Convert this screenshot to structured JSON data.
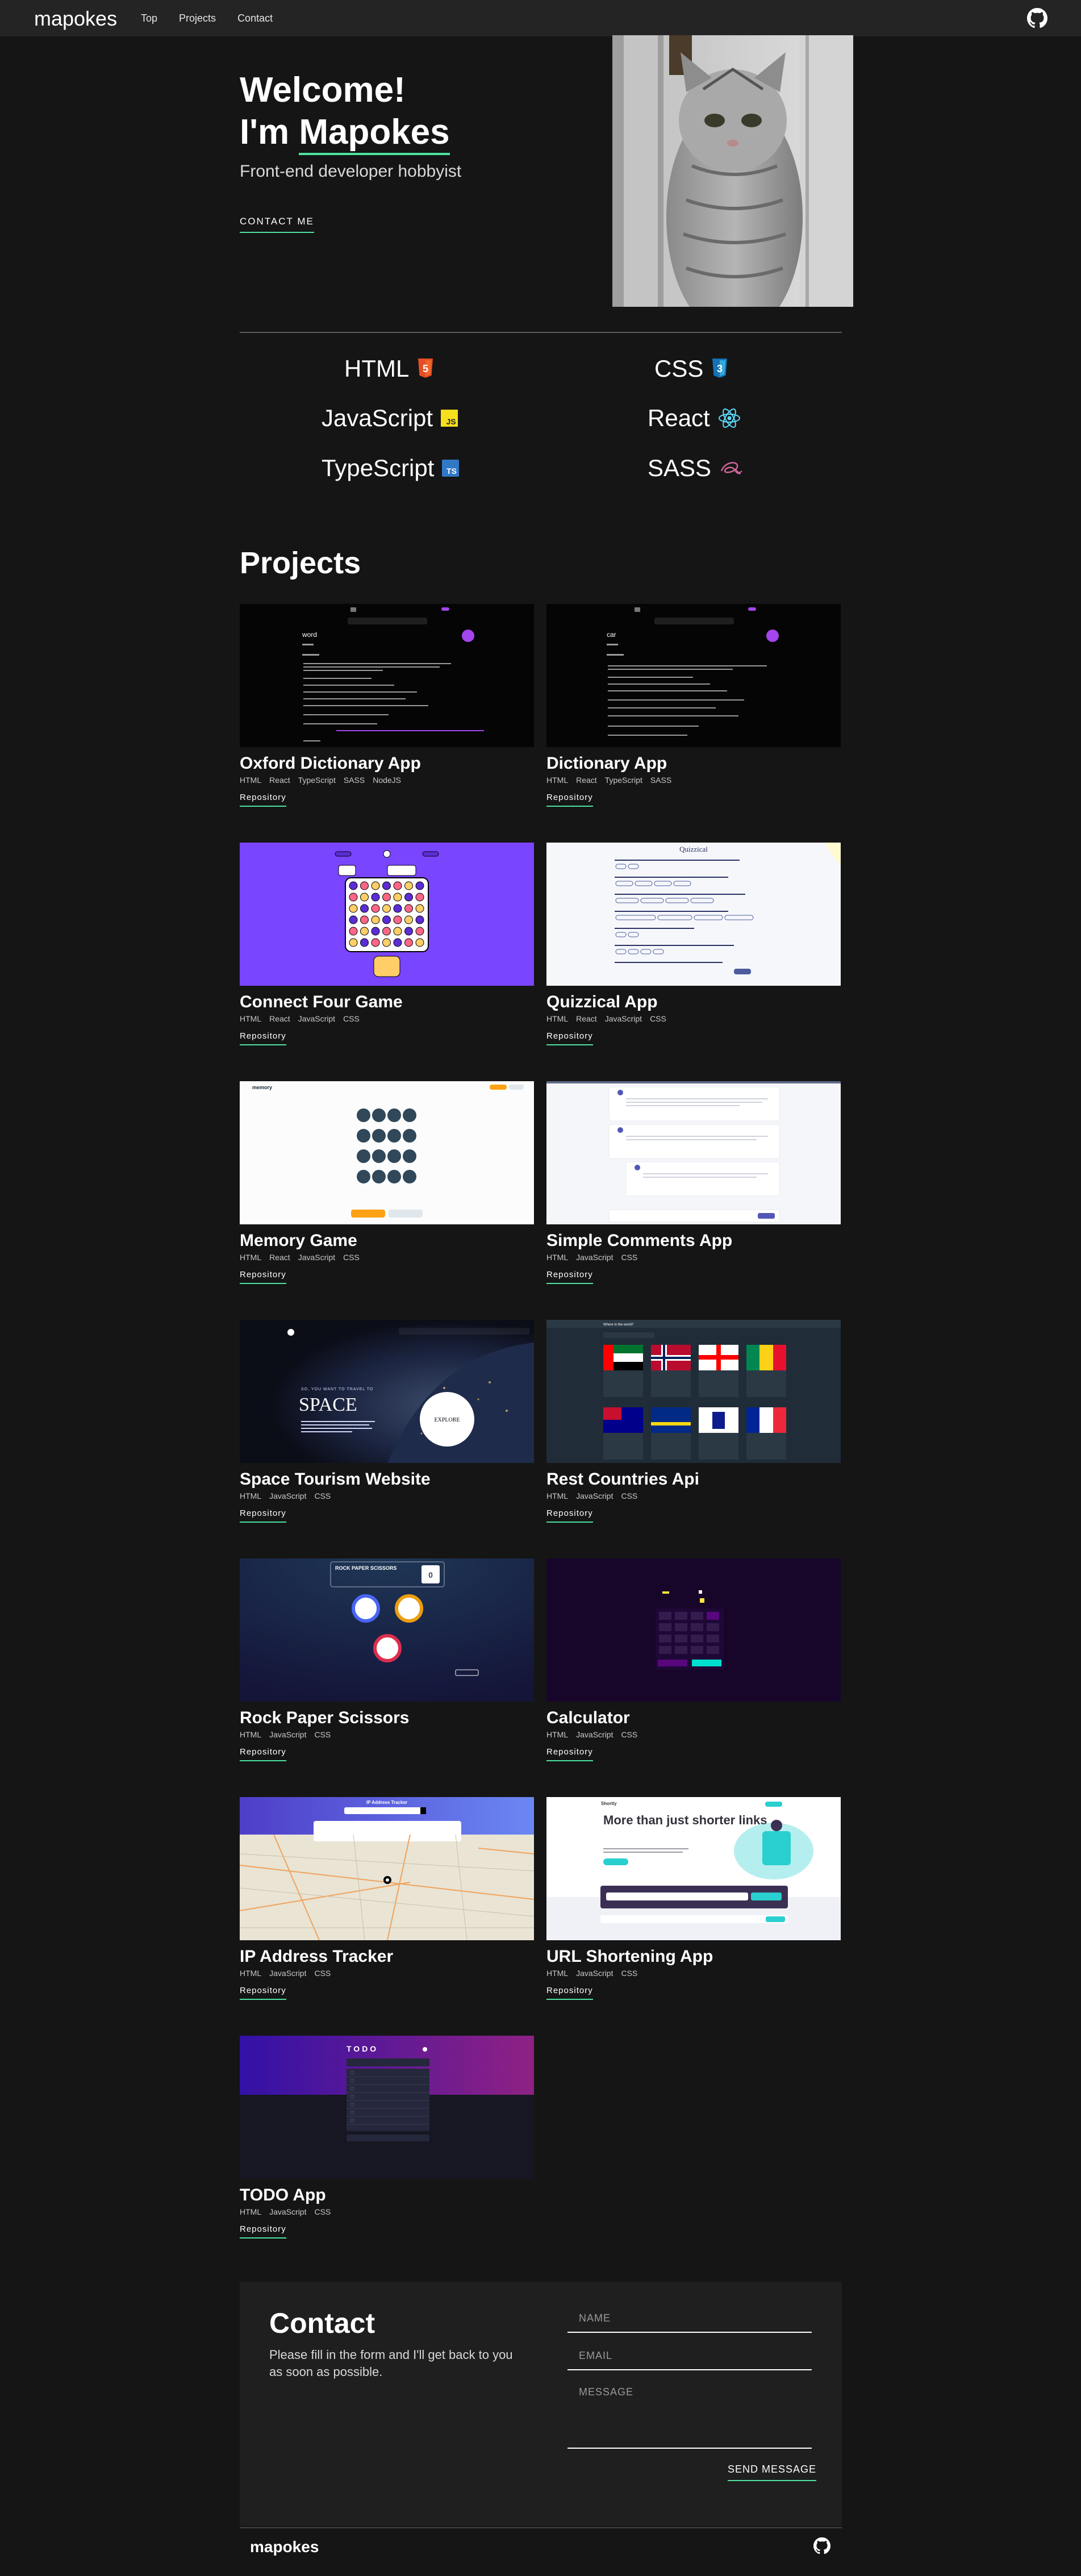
{
  "nav": {
    "brand": "mapokes",
    "links": [
      "Top",
      "Projects",
      "Contact"
    ],
    "github_icon": "github-icon"
  },
  "hero": {
    "title_line1": "Welcome!",
    "title_prefix": "I'm ",
    "title_name": "Mapokes",
    "subtitle": "Front-end developer hobbyist",
    "cta": "CONTACT ME",
    "image": "cat-photo"
  },
  "skills": [
    {
      "name": "HTML",
      "icon": "html5-icon"
    },
    {
      "name": "CSS",
      "icon": "css3-icon"
    },
    {
      "name": "JavaScript",
      "icon": "javascript-icon"
    },
    {
      "name": "React",
      "icon": "react-icon"
    },
    {
      "name": "TypeScript",
      "icon": "typescript-icon"
    },
    {
      "name": "SASS",
      "icon": "sass-icon"
    }
  ],
  "projects": {
    "heading": "Projects",
    "items": [
      {
        "title": "Oxford Dictionary App",
        "tags": [
          "HTML",
          "React",
          "TypeScript",
          "SASS",
          "NodeJS"
        ],
        "repo": "Repository"
      },
      {
        "title": "Dictionary App",
        "tags": [
          "HTML",
          "React",
          "TypeScript",
          "SASS"
        ],
        "repo": "Repository"
      },
      {
        "title": "Connect Four Game",
        "tags": [
          "HTML",
          "React",
          "JavaScript",
          "CSS"
        ],
        "repo": "Repository"
      },
      {
        "title": "Quizzical App",
        "tags": [
          "HTML",
          "React",
          "JavaScript",
          "CSS"
        ],
        "repo": "Repository"
      },
      {
        "title": "Memory Game",
        "tags": [
          "HTML",
          "React",
          "JavaScript",
          "CSS"
        ],
        "repo": "Repository"
      },
      {
        "title": "Simple Comments App",
        "tags": [
          "HTML",
          "JavaScript",
          "CSS"
        ],
        "repo": "Repository"
      },
      {
        "title": "Space Tourism Website",
        "tags": [
          "HTML",
          "JavaScript",
          "CSS"
        ],
        "repo": "Repository"
      },
      {
        "title": "Rest Countries Api",
        "tags": [
          "HTML",
          "JavaScript",
          "CSS"
        ],
        "repo": "Repository"
      },
      {
        "title": "Rock Paper Scissors",
        "tags": [
          "HTML",
          "JavaScript",
          "CSS"
        ],
        "repo": "Repository"
      },
      {
        "title": "Calculator",
        "tags": [
          "HTML",
          "JavaScript",
          "CSS"
        ],
        "repo": "Repository"
      },
      {
        "title": "IP Address Tracker",
        "tags": [
          "HTML",
          "JavaScript",
          "CSS"
        ],
        "repo": "Repository"
      },
      {
        "title": "URL Shortening App",
        "tags": [
          "HTML",
          "JavaScript",
          "CSS"
        ],
        "repo": "Repository"
      },
      {
        "title": "TODO App",
        "tags": [
          "HTML",
          "JavaScript",
          "CSS"
        ],
        "repo": "Repository"
      }
    ]
  },
  "thumb_text": {
    "word": "word",
    "car": "car",
    "quizzical": "Quizzical",
    "memory": "memory",
    "space_small": "SO, YOU WANT TO TRAVEL TO",
    "space": "SPACE",
    "explore": "EXPLORE",
    "rps": "ROCK PAPER SCISSORS",
    "score": "0",
    "ip_title": "IP Address Tracker",
    "shortly_h": "More than just shorter links",
    "shortly_logo": "Shortly",
    "todo": "TODO",
    "countries_h": "Where in the world?"
  },
  "contact": {
    "title": "Contact",
    "description": "Please fill in the form and I'll get back to you as soon as possible.",
    "name_placeholder": "NAME",
    "email_placeholder": "EMAIL",
    "message_placeholder": "MESSAGE",
    "send": "SEND MESSAGE"
  },
  "footer": {
    "brand": "mapokes",
    "github_icon": "github-icon"
  },
  "colors": {
    "accent": "#4ee1a0",
    "background": "#151515",
    "nav": "#242424"
  }
}
